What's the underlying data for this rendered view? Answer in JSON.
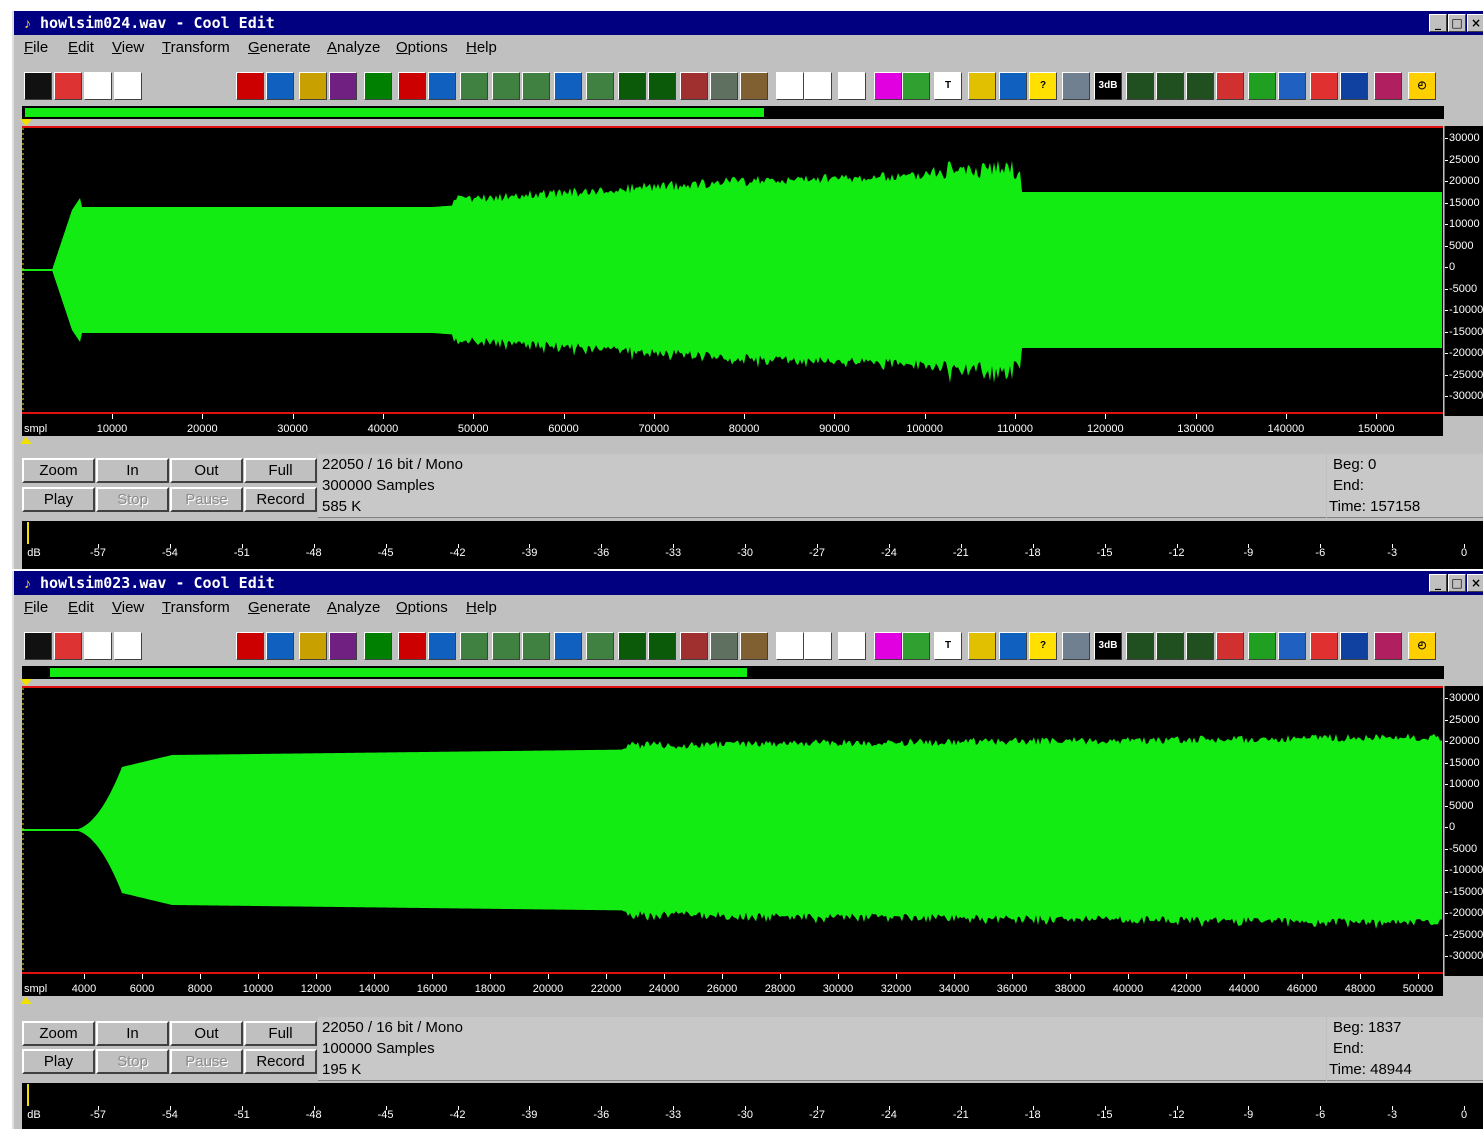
{
  "colors": {
    "titlebar": "#000080",
    "waveform": "#13ec13",
    "background": "#000000",
    "marker": "#f0e000"
  },
  "tool_icons": [
    "blank-line-icon",
    "open-file-icon",
    "save-icon",
    "headphones-icon",
    "mute-icon",
    "noise-icon",
    "envelope-icon",
    "echo-icon",
    "amplify-icon",
    "invert-icon",
    "fade-icon",
    "filter-icon",
    "filter-2-icon",
    "filter-3-icon",
    "reverb-icon",
    "stretch-icon",
    "spectrum-icon",
    "spectrum-2-icon",
    "delete-icon",
    "noise-2-icon",
    "brush-icon",
    "arrow-icon",
    "list-icon",
    "note-icon",
    "cursor-icon",
    "scan-icon",
    "text-icon",
    "eq-icon",
    "loop-icon",
    "help-icon",
    "cd-icon",
    "3db-icon",
    "graph-icon",
    "graph-2-icon",
    "line-icon",
    "mirror-icon",
    "curve-icon",
    "wave-icon",
    "bars-icon",
    "play-range-icon",
    "meter-icon",
    "clock-icon"
  ],
  "windows": [
    {
      "title": "howlsim024.wav - Cool Edit",
      "icon": "app-icon",
      "controls": [
        "_",
        "□",
        "×"
      ],
      "menu": [
        "File",
        "Edit",
        "View",
        "Transform",
        "Generate",
        "Analyze",
        "Options",
        "Help"
      ],
      "overview_fill_fraction": 0.52,
      "y_labels": [
        "30000",
        "25000",
        "20000",
        "15000",
        "10000",
        "5000",
        "0",
        "-5000",
        "-10000",
        "-15000",
        "-20000",
        "-25000",
        "-30000"
      ],
      "ruler_unit": "smpl",
      "ruler_labels": [
        "10000",
        "20000",
        "30000",
        "40000",
        "50000",
        "60000",
        "70000",
        "80000",
        "90000",
        "100000",
        "110000",
        "120000",
        "130000",
        "140000",
        "150000"
      ],
      "buttons": {
        "zoom": "Zoom",
        "in": "In",
        "out": "Out",
        "full": "Full",
        "play": "Play",
        "stop": "Stop",
        "pause": "Pause",
        "record": "Record"
      },
      "info": {
        "format": "22050 / 16 bit / Mono",
        "samples": "300000 Samples",
        "size": "585 K"
      },
      "selection": {
        "beg": "Beg: 0",
        "end": "End:",
        "time": "Time: 157158"
      },
      "db_unit": "dB",
      "db_labels": [
        "-57",
        "-54",
        "-51",
        "-48",
        "-45",
        "-42",
        "-39",
        "-36",
        "-33",
        "-30",
        "-27",
        "-24",
        "-21",
        "-18",
        "-15",
        "-12",
        "-9",
        "-6",
        "-3",
        "0"
      ]
    },
    {
      "title": "howlsim023.wav - Cool Edit",
      "icon": "app-icon",
      "controls": [
        "_",
        "□",
        "×"
      ],
      "menu": [
        "File",
        "Edit",
        "View",
        "Transform",
        "Generate",
        "Analyze",
        "Options",
        "Help"
      ],
      "overview_fill_fraction": 0.49,
      "y_labels": [
        "30000",
        "25000",
        "20000",
        "15000",
        "10000",
        "5000",
        "0",
        "-5000",
        "-10000",
        "-15000",
        "-20000",
        "-25000",
        "-30000"
      ],
      "ruler_unit": "smpl",
      "ruler_labels": [
        "4000",
        "6000",
        "8000",
        "10000",
        "12000",
        "14000",
        "16000",
        "18000",
        "20000",
        "22000",
        "24000",
        "26000",
        "28000",
        "30000",
        "32000",
        "34000",
        "36000",
        "38000",
        "40000",
        "42000",
        "44000",
        "46000",
        "48000",
        "50000"
      ],
      "buttons": {
        "zoom": "Zoom",
        "in": "In",
        "out": "Out",
        "full": "Full",
        "play": "Play",
        "stop": "Stop",
        "pause": "Pause",
        "record": "Record"
      },
      "info": {
        "format": "22050 / 16 bit / Mono",
        "samples": "100000 Samples",
        "size": "195 K"
      },
      "selection": {
        "beg": "Beg: 1837",
        "end": "End:",
        "time": "Time: 48944"
      },
      "db_unit": "dB",
      "db_labels": [
        "-57",
        "-54",
        "-51",
        "-48",
        "-45",
        "-42",
        "-39",
        "-36",
        "-33",
        "-30",
        "-27",
        "-24",
        "-21",
        "-18",
        "-15",
        "-12",
        "-9",
        "-6",
        "-3",
        "0"
      ]
    }
  ]
}
